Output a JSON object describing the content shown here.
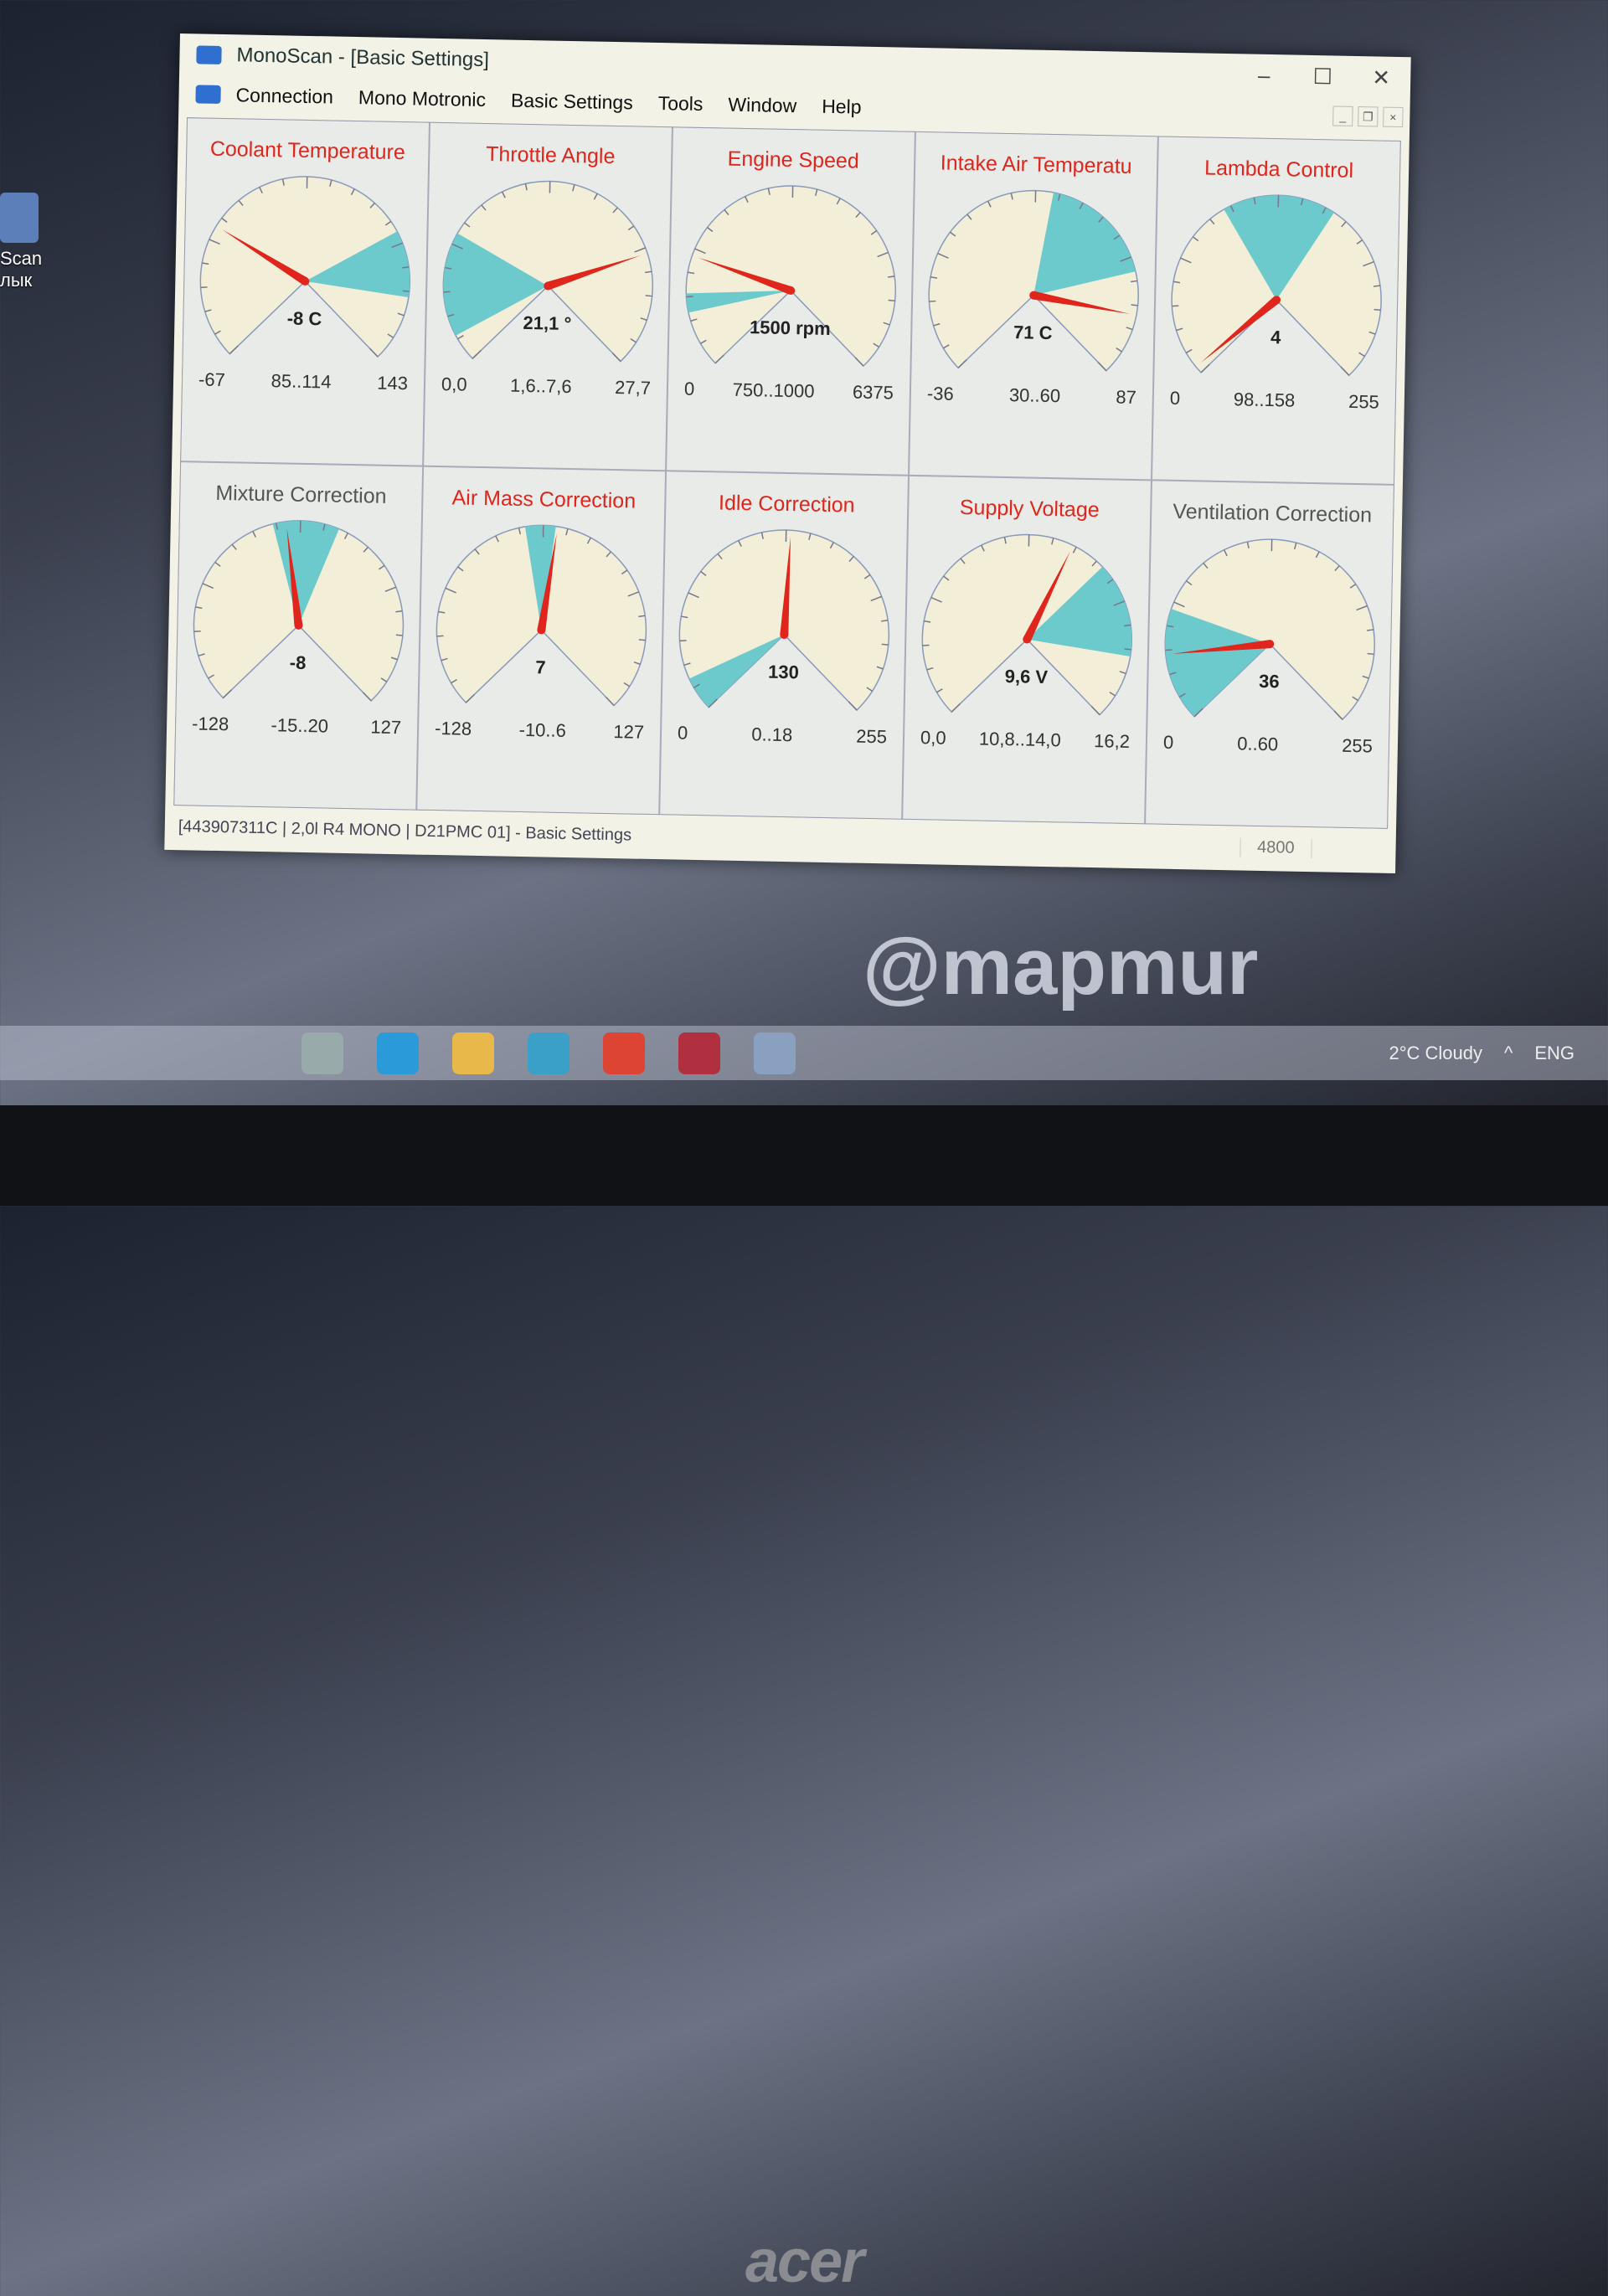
{
  "desktop": {
    "icons": [
      {
        "label": "Scan"
      },
      {
        "label": "лык"
      }
    ],
    "watermark": "@mapmur",
    "monitor_brand": "acer"
  },
  "window": {
    "title": "MonoScan - [Basic Settings]",
    "controls": {
      "minimize": "–",
      "maximize": "☐",
      "close": "✕"
    },
    "menu": [
      "Connection",
      "Mono Motronic",
      "Basic Settings",
      "Tools",
      "Window",
      "Help"
    ],
    "mdi_controls": [
      "_",
      "❐",
      "×"
    ]
  },
  "colors": {
    "needle": "#e0261c",
    "sector": "#6cc9cc",
    "dial": "#f3eed8",
    "title_red": "#e0261c",
    "title_gray": "#555555"
  },
  "gauges": [
    {
      "title": "Coolant Temperature",
      "title_color": "red",
      "min": -67,
      "max": 143,
      "min_label": "-67",
      "max_label": "143",
      "range_label": "85..114",
      "range": [
        85,
        114
      ],
      "value": -8,
      "value_text": "-8 C"
    },
    {
      "title": "Throttle Angle",
      "title_color": "red",
      "min": 0,
      "max": 27.7,
      "min_label": "0,0",
      "max_label": "27,7",
      "range_label": "1,6..7,6",
      "range": [
        1.6,
        7.6
      ],
      "value": 21.1,
      "value_text": "21,1 °"
    },
    {
      "title": "Engine Speed",
      "title_color": "red",
      "min": 0,
      "max": 6375,
      "min_label": "0",
      "max_label": "6375",
      "range_label": "750..1000",
      "range": [
        750,
        1000
      ],
      "value": 1500,
      "value_text": "1500 rpm"
    },
    {
      "title": "Intake Air Temperatu",
      "title_color": "red",
      "min": -36,
      "max": 87,
      "min_label": "-36",
      "max_label": "87",
      "range_label": "30..60",
      "range": [
        30,
        60
      ],
      "value": 71,
      "value_text": "71 C"
    },
    {
      "title": "Lambda Control",
      "title_color": "red",
      "min": 0,
      "max": 255,
      "min_label": "0",
      "max_label": "255",
      "range_label": "98..158",
      "range": [
        98,
        158
      ],
      "value": 4,
      "value_text": "4"
    },
    {
      "title": "Mixture Correction",
      "title_color": "gray",
      "min": -128,
      "max": 127,
      "min_label": "-128",
      "max_label": "127",
      "range_label": "-15..20",
      "range": [
        -15,
        20
      ],
      "value": -8,
      "value_text": "-8"
    },
    {
      "title": "Air Mass Correction",
      "title_color": "red",
      "min": -128,
      "max": 127,
      "min_label": "-128",
      "max_label": "127",
      "range_label": "-10..6",
      "range": [
        -10,
        6
      ],
      "value": 7,
      "value_text": "7"
    },
    {
      "title": "Idle Correction",
      "title_color": "red",
      "min": 0,
      "max": 255,
      "min_label": "0",
      "max_label": "255",
      "range_label": "0..18",
      "range": [
        0,
        18
      ],
      "value": 130,
      "value_text": "130"
    },
    {
      "title": "Supply Voltage",
      "title_color": "red",
      "min": 0,
      "max": 16.2,
      "min_label": "0,0",
      "max_label": "16,2",
      "range_label": "10,8..14,0",
      "range": [
        10.8,
        14.0
      ],
      "value": 9.6,
      "value_text": "9,6 V"
    },
    {
      "title": "Ventilation Correction",
      "title_color": "gray",
      "min": 0,
      "max": 255,
      "min_label": "0",
      "max_label": "255",
      "range_label": "0..60",
      "range": [
        0,
        60
      ],
      "value": 36,
      "value_text": "36"
    }
  ],
  "statusbar": {
    "text": "[443907311C  |  2,0l R4 MONO  |  D21PMC 01] - Basic Settings",
    "baud": "4800"
  },
  "taskbar": {
    "icons": [
      "task-view",
      "edge",
      "file-explorer",
      "mail",
      "chrome",
      "app",
      "monoscan"
    ],
    "weather": "2°C Cloudy",
    "lang": "ENG"
  }
}
